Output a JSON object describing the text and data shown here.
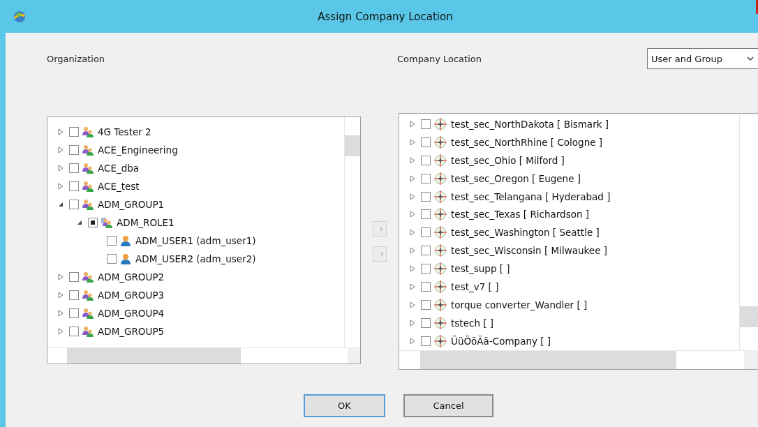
{
  "window": {
    "title": "Assign Company Location"
  },
  "organization": {
    "label": "Organization",
    "tree": [
      {
        "label": "4G Tester 2",
        "kind": "group",
        "expanded": false,
        "checked": false,
        "indeterminate": false
      },
      {
        "label": "ACE_Engineering",
        "kind": "group",
        "expanded": false,
        "checked": false,
        "indeterminate": false
      },
      {
        "label": "ACE_dba",
        "kind": "group",
        "expanded": false,
        "checked": false,
        "indeterminate": false
      },
      {
        "label": "ACE_test",
        "kind": "group",
        "expanded": false,
        "checked": false,
        "indeterminate": false
      },
      {
        "label": "ADM_GROUP1",
        "kind": "group",
        "expanded": true,
        "checked": false,
        "indeterminate": false,
        "children": [
          {
            "label": "ADM_ROLE1",
            "kind": "role",
            "expanded": true,
            "checked": false,
            "indeterminate": true,
            "children": [
              {
                "label": "ADM_USER1 (adm_user1)",
                "kind": "user",
                "checked": false,
                "indeterminate": false
              },
              {
                "label": "ADM_USER2 (adm_user2)",
                "kind": "user",
                "checked": false,
                "indeterminate": false
              }
            ]
          }
        ]
      },
      {
        "label": "ADM_GROUP2",
        "kind": "group",
        "expanded": false,
        "checked": false,
        "indeterminate": false
      },
      {
        "label": "ADM_GROUP3",
        "kind": "group",
        "expanded": false,
        "checked": false,
        "indeterminate": false
      },
      {
        "label": "ADM_GROUP4",
        "kind": "group",
        "expanded": false,
        "checked": false,
        "indeterminate": false
      },
      {
        "label": "ADM_GROUP5",
        "kind": "group",
        "expanded": false,
        "checked": false,
        "indeterminate": false
      }
    ]
  },
  "transfer_buttons": [
    {
      "kind": "add",
      "disabled": true
    },
    {
      "kind": "remove",
      "disabled": true
    }
  ],
  "company_location": {
    "label": "Company Location",
    "filter": {
      "value": "User and Group"
    },
    "tree": [
      {
        "label": "test_sec_NorthDakota [ Bismark ]",
        "kind": "location",
        "expanded": false,
        "checked": false,
        "indeterminate": false
      },
      {
        "label": "test_sec_NorthRhine [ Cologne ]",
        "kind": "location",
        "expanded": false,
        "checked": false,
        "indeterminate": false
      },
      {
        "label": "test_sec_Ohio [ Milford ]",
        "kind": "location",
        "expanded": false,
        "checked": false,
        "indeterminate": false
      },
      {
        "label": "test_sec_Oregon [ Eugene ]",
        "kind": "location",
        "expanded": false,
        "checked": false,
        "indeterminate": false
      },
      {
        "label": "test_sec_Telangana [ Hyderabad ]",
        "kind": "location",
        "expanded": false,
        "checked": false,
        "indeterminate": false
      },
      {
        "label": "test_sec_Texas [ Richardson ]",
        "kind": "location",
        "expanded": false,
        "checked": false,
        "indeterminate": false
      },
      {
        "label": "test_sec_Washington [ Seattle ]",
        "kind": "location",
        "expanded": false,
        "checked": false,
        "indeterminate": false
      },
      {
        "label": "test_sec_Wisconsin [ Milwaukee ]",
        "kind": "location",
        "expanded": false,
        "checked": false,
        "indeterminate": false
      },
      {
        "label": "test_supp [  ]",
        "kind": "location",
        "expanded": false,
        "checked": false,
        "indeterminate": false
      },
      {
        "label": "test_v7 [  ]",
        "kind": "location",
        "expanded": false,
        "checked": false,
        "indeterminate": false
      },
      {
        "label": "torque converter_Wandler [  ]",
        "kind": "location",
        "expanded": false,
        "checked": false,
        "indeterminate": false
      },
      {
        "label": "tstech [  ]",
        "kind": "location",
        "expanded": false,
        "checked": false,
        "indeterminate": false
      },
      {
        "label": "ÜüÖöÄä-Company [  ]",
        "kind": "location",
        "expanded": false,
        "checked": false,
        "indeterminate": false
      }
    ]
  },
  "buttons": [
    {
      "label": "OK",
      "default": true
    },
    {
      "label": "Cancel",
      "default": false
    }
  ]
}
